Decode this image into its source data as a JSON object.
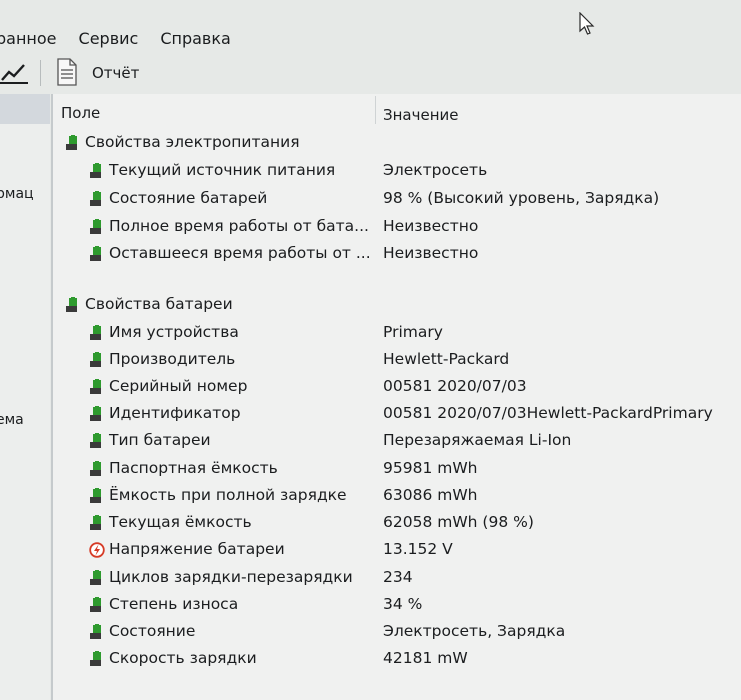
{
  "menu": {
    "items": [
      "ранное",
      "Сервис",
      "Справка"
    ]
  },
  "toolbar": {
    "report_label": "Отчёт"
  },
  "left_pane": {
    "fragment_1": "рмац",
    "fragment_2": "ема"
  },
  "table": {
    "headers": {
      "field": "Поле",
      "value": "Значение"
    },
    "rows": [
      {
        "label": "Свойства электропитания",
        "value": ""
      },
      {
        "label": "Текущий источник питания",
        "value": "Электросеть"
      },
      {
        "label": "Состояние батарей",
        "value": "98 % (Высокий уровень, Зарядка)"
      },
      {
        "label": "Полное время работы от бата...",
        "value": "Неизвестно"
      },
      {
        "label": "Оставшееся время работы от ...",
        "value": "Неизвестно"
      },
      {
        "label": "Свойства батареи",
        "value": ""
      },
      {
        "label": "Имя устройства",
        "value": "Primary"
      },
      {
        "label": "Производитель",
        "value": "Hewlett-Packard"
      },
      {
        "label": "Серийный номер",
        "value": "00581 2020/07/03"
      },
      {
        "label": "Идентификатор",
        "value": "00581 2020/07/03Hewlett-PackardPrimary"
      },
      {
        "label": "Тип батареи",
        "value": "Перезаряжаемая Li-Ion"
      },
      {
        "label": "Паспортная ёмкость",
        "value": "95981 mWh"
      },
      {
        "label": "Ёмкость при полной зарядке",
        "value": "63086 mWh"
      },
      {
        "label": "Текущая ёмкость",
        "value": "62058 mWh  (98 %)"
      },
      {
        "label": "Напряжение батареи",
        "value": "13.152 V"
      },
      {
        "label": "Циклов зарядки-перезарядки",
        "value": "234"
      },
      {
        "label": "Степень износа",
        "value": "34 %"
      },
      {
        "label": "Состояние",
        "value": "Электросеть, Зарядка"
      },
      {
        "label": "Скорость зарядки",
        "value": "42181 mW"
      }
    ]
  },
  "icons": {
    "battery_icon": "battery-icon",
    "voltage_icon": "voltage-icon",
    "report_icon": "report-icon",
    "chart_icon": "chart-icon"
  },
  "colors": {
    "battery_green": "#2e9a2e",
    "voltage_red": "#d63a25",
    "window_bg": "#e6e9e7"
  }
}
